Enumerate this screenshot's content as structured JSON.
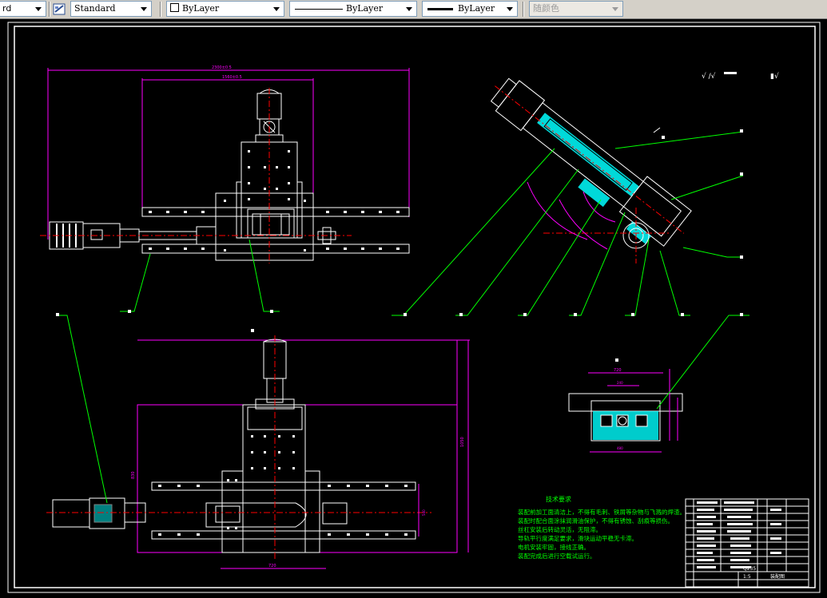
{
  "toolbar": {
    "text_style_partial": "rd",
    "dim_style": "Standard",
    "layer": "ByLayer",
    "linetype": "ByLayer",
    "lineweight": "ByLayer",
    "plot_style": "随颜色"
  },
  "drawing": {
    "tech_req_title": "技术要求",
    "tech_req_lines": [
      "装配前加工面清洁上，不得有毛刺、铁屑等杂物与飞溅的焊渣。",
      "装配时配合面涂抹润滑油保护，不得有锈蚀、刮痕等损伤。",
      "丝杠安装后转动灵活，无阻滞。",
      "导轨平行度满足要求，滑块运动平稳无卡滞。",
      "电机安装牢固，接线正确。",
      "装配完成后进行空载试运行。"
    ],
    "title_block_material": "Q235",
    "title_block_scale": "1:5",
    "title_block_name": "装配图",
    "dim_overall_top": "2300±0.5",
    "dim_inner_top": "1560±0.5",
    "dim_section_w": "720",
    "dim_section_inner": "240",
    "dim_section_bottom": "480",
    "dim_bottom_height": "1050",
    "dim_bottom_w": "720",
    "dim_bottom_right": "540",
    "dim_left_height": "830",
    "colors": {
      "background": "#000000",
      "white": "#ffffff",
      "magenta": "#ff00ff",
      "green": "#00ff00",
      "red": "#ff0000",
      "cyan": "#00ffff",
      "toolbar": "#d4d0c8"
    }
  }
}
